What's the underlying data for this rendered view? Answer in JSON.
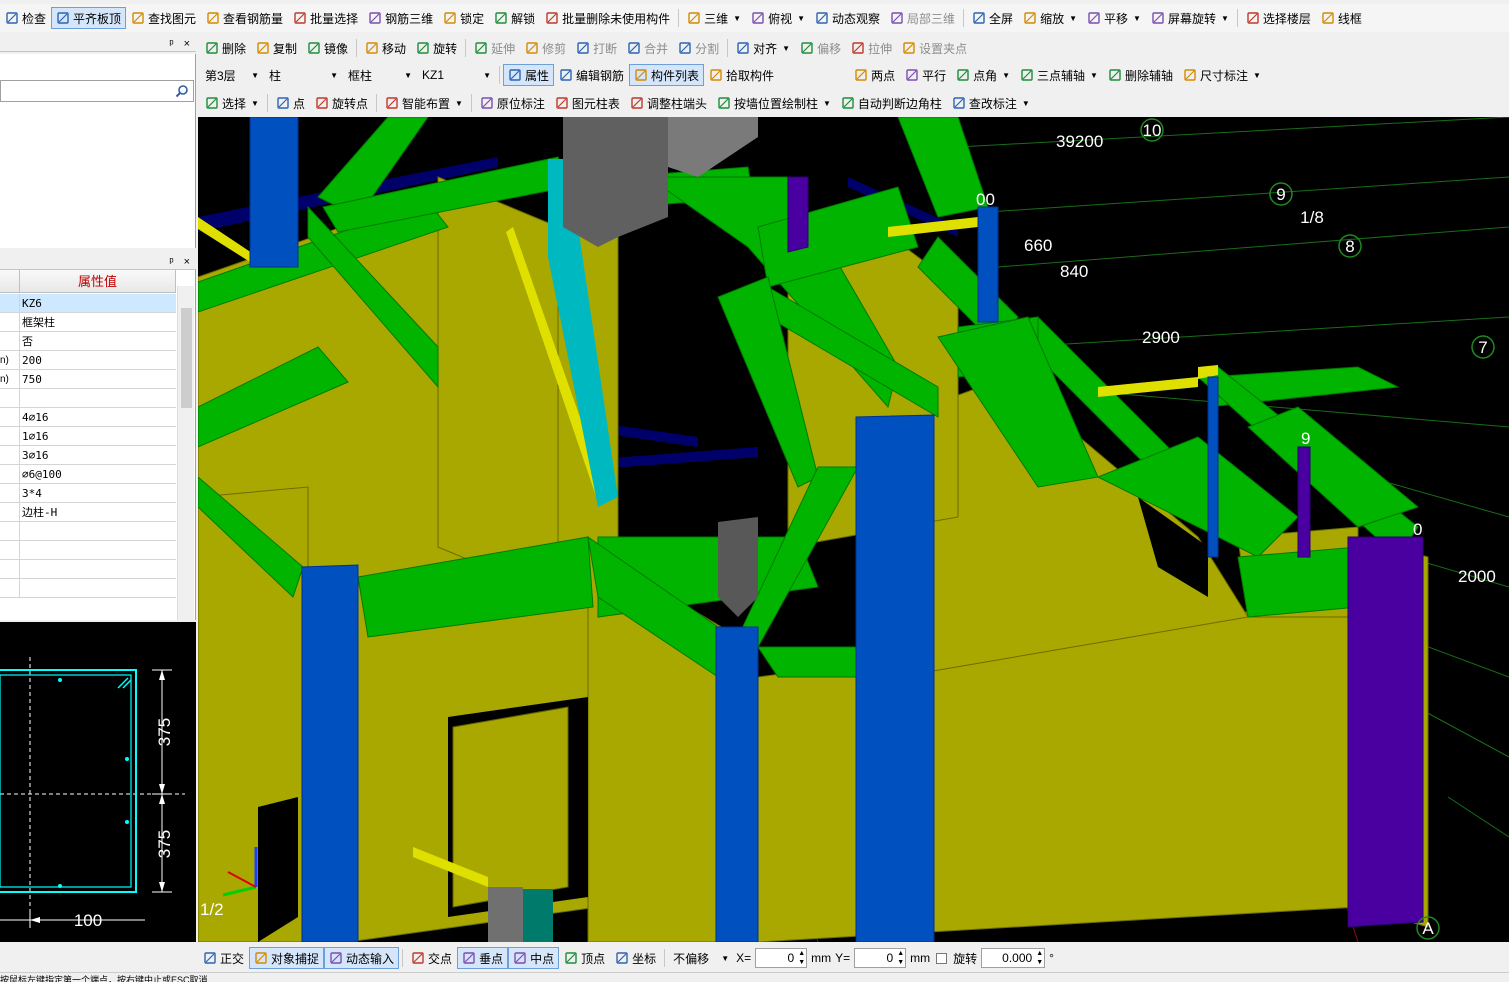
{
  "toolbar1": {
    "items": [
      {
        "label": "检查",
        "icon": "check-icon"
      },
      {
        "label": "平齐板顶",
        "icon": "align-slab-icon",
        "active": true
      },
      {
        "label": "查找图元",
        "icon": "find-icon"
      },
      {
        "label": "查看钢筋量",
        "icon": "rebar-qty-icon"
      },
      {
        "label": "批量选择",
        "icon": "batch-select-icon"
      },
      {
        "label": "钢筋三维",
        "icon": "rebar-3d-icon"
      },
      {
        "label": "锁定",
        "icon": "lock-icon"
      },
      {
        "label": "解锁",
        "icon": "unlock-icon"
      },
      {
        "label": "批量删除未使用构件",
        "icon": "batch-delete-icon"
      },
      {
        "label": "三维",
        "icon": "cube-icon",
        "dropdown": true
      },
      {
        "label": "俯视",
        "icon": "top-view-icon",
        "dropdown": true
      },
      {
        "label": "动态观察",
        "icon": "orbit-icon"
      },
      {
        "label": "局部三维",
        "icon": "local-3d-icon",
        "disabled": true
      },
      {
        "label": "全屏",
        "icon": "fullscreen-icon"
      },
      {
        "label": "缩放",
        "icon": "zoom-icon",
        "dropdown": true
      },
      {
        "label": "平移",
        "icon": "pan-icon",
        "dropdown": true
      },
      {
        "label": "屏幕旋转",
        "icon": "screen-rotate-icon",
        "dropdown": true
      },
      {
        "label": "选择楼层",
        "icon": "floor-select-icon"
      },
      {
        "label": "线框",
        "icon": "wireframe-icon"
      }
    ]
  },
  "toolbar2": {
    "items": [
      {
        "label": "删除",
        "icon": "delete-icon"
      },
      {
        "label": "复制",
        "icon": "copy-icon"
      },
      {
        "label": "镜像",
        "icon": "mirror-icon"
      },
      {
        "label": "移动",
        "icon": "move-icon"
      },
      {
        "label": "旋转",
        "icon": "rotate-icon"
      },
      {
        "label": "延伸",
        "icon": "extend-icon",
        "disabled": true
      },
      {
        "label": "修剪",
        "icon": "trim-icon",
        "disabled": true
      },
      {
        "label": "打断",
        "icon": "break-icon",
        "disabled": true
      },
      {
        "label": "合并",
        "icon": "merge-icon",
        "disabled": true
      },
      {
        "label": "分割",
        "icon": "split-icon",
        "disabled": true
      },
      {
        "label": "对齐",
        "icon": "align-icon",
        "dropdown": true
      },
      {
        "label": "偏移",
        "icon": "offset-icon",
        "disabled": true
      },
      {
        "label": "拉伸",
        "icon": "stretch-icon",
        "disabled": true
      },
      {
        "label": "设置夹点",
        "icon": "grip-icon",
        "disabled": true
      }
    ]
  },
  "toolbar3": {
    "selectors": [
      {
        "value": "第3层"
      },
      {
        "value": "柱"
      },
      {
        "value": "框柱"
      },
      {
        "value": "KZ1"
      }
    ],
    "items": [
      {
        "label": "属性",
        "icon": "properties-icon",
        "active": true
      },
      {
        "label": "编辑钢筋",
        "icon": "edit-rebar-icon"
      },
      {
        "label": "构件列表",
        "icon": "component-list-icon",
        "active": true
      },
      {
        "label": "拾取构件",
        "icon": "pick-icon"
      }
    ],
    "axis_items": [
      {
        "label": "两点",
        "icon": "two-point-axis-icon"
      },
      {
        "label": "平行",
        "icon": "parallel-axis-icon"
      },
      {
        "label": "点角",
        "icon": "point-angle-icon",
        "dropdown": true
      },
      {
        "label": "三点辅轴",
        "icon": "three-point-axis-icon",
        "dropdown": true
      },
      {
        "label": "删除辅轴",
        "icon": "delete-axis-icon"
      },
      {
        "label": "尺寸标注",
        "icon": "dimension-icon",
        "dropdown": true
      }
    ]
  },
  "toolbar4": {
    "items": [
      {
        "label": "选择",
        "icon": "select-icon",
        "dropdown": true
      },
      {
        "label": "点",
        "icon": "point-icon"
      },
      {
        "label": "旋转点",
        "icon": "rotate-point-icon"
      },
      {
        "label": "智能布置",
        "icon": "smart-layout-icon",
        "dropdown": true
      },
      {
        "label": "原位标注",
        "icon": "inplace-label-icon"
      },
      {
        "label": "图元柱表",
        "icon": "column-table-icon"
      },
      {
        "label": "调整柱端头",
        "icon": "adjust-column-end-icon"
      },
      {
        "label": "按墙位置绘制柱",
        "icon": "wall-column-icon",
        "dropdown": true
      },
      {
        "label": "自动判断边角柱",
        "icon": "auto-corner-icon"
      },
      {
        "label": "查改标注",
        "icon": "edit-label-icon",
        "dropdown": true
      }
    ]
  },
  "nav_panel": {
    "pin": "ᵖ",
    "close": "×"
  },
  "prop_panel": {
    "pin": "ᵖ",
    "close": "×",
    "header_value": "属性值",
    "rows": [
      {
        "key": "",
        "value": "KZ6",
        "selected": true
      },
      {
        "key": "",
        "value": "框架柱"
      },
      {
        "key": "",
        "value": "否"
      },
      {
        "key": "n)",
        "value": "200"
      },
      {
        "key": "n)",
        "value": "750"
      },
      {
        "key": "",
        "value": ""
      },
      {
        "key": "",
        "value": "4⌀16"
      },
      {
        "key": "",
        "value": "1⌀16"
      },
      {
        "key": "",
        "value": "3⌀16"
      },
      {
        "key": "",
        "value": "⌀6@100"
      },
      {
        "key": "",
        "value": "3*4"
      },
      {
        "key": "",
        "value": "边柱-H"
      },
      {
        "key": "",
        "value": ""
      },
      {
        "key": "",
        "value": ""
      },
      {
        "key": "",
        "value": ""
      },
      {
        "key": "",
        "value": ""
      }
    ]
  },
  "section_view": {
    "dim_top": "375",
    "dim_bottom": "375",
    "dim_width": "100"
  },
  "viewport": {
    "dims": [
      "39200",
      "00",
      "660",
      "840",
      "2900",
      "2000",
      "9",
      "0"
    ],
    "axis_labels": [
      "10",
      "9",
      "1/8",
      "8",
      "7",
      "A"
    ],
    "corner_label": "1/2"
  },
  "statusbar": {
    "items": [
      {
        "label": "正交",
        "icon": "ortho-icon"
      },
      {
        "label": "对象捕捉",
        "icon": "snap-icon",
        "active": true
      },
      {
        "label": "动态输入",
        "icon": "dynamic-input-icon",
        "active": true
      },
      {
        "label": "交点",
        "icon": "intersection-icon"
      },
      {
        "label": "垂点",
        "icon": "perpendicular-icon",
        "active": true
      },
      {
        "label": "中点",
        "icon": "midpoint-icon",
        "active": true
      },
      {
        "label": "顶点",
        "icon": "vertex-icon"
      },
      {
        "label": "坐标",
        "icon": "coordinate-icon"
      }
    ],
    "offset_mode": "不偏移",
    "x_label": "X=",
    "x_value": "0",
    "y_label": "Y=",
    "y_value": "0",
    "unit": "mm",
    "rotate_label": "旋转",
    "rotate_value": "0.000",
    "degree": "°"
  },
  "bottom_strip": {
    "text": "按鼠标左键指定第一个端点，按右键中止或ESC取消"
  }
}
